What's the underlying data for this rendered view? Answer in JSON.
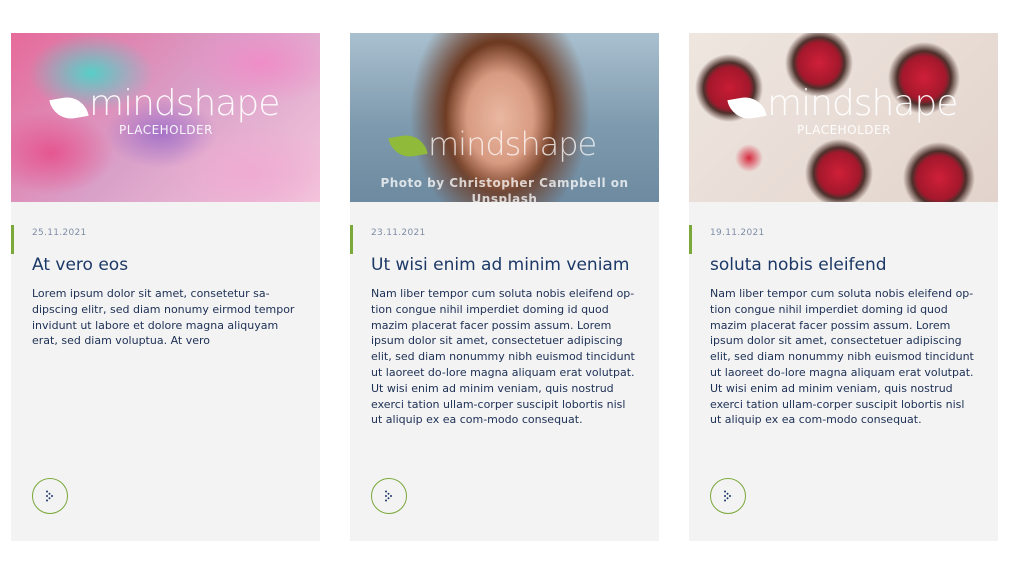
{
  "cards": [
    {
      "image": "donuts-photo",
      "watermark": {
        "brand": "mindshape",
        "sub": "PLACEHOLDER"
      },
      "credit": "",
      "date": "25.11.2021",
      "title": "At vero eos",
      "text": "Lorem ipsum dolor sit amet, consetetur sa-dipscing elitr, sed diam nonumy eirmod tempor invidunt ut labore et dolore magna aliquyam erat, sed diam voluptua. At vero",
      "button_icon": "arrow-right-icon"
    },
    {
      "image": "portrait-photo",
      "watermark": {
        "brand": "mindshape",
        "sub": ""
      },
      "credit": "Photo by Christopher Campbell on Unsplash",
      "date": "23.11.2021",
      "title": "Ut wisi enim ad minim veniam",
      "text": "Nam liber tempor cum soluta nobis eleifend op-tion congue nihil imperdiet doming id quod mazim placerat facer possim assum. Lorem ipsum dolor sit amet, consectetuer adipiscing elit, sed diam nonummy nibh euismod tincidunt ut laoreet do-lore magna aliquam erat volutpat. Ut wisi enim ad minim veniam, quis nostrud exerci tation ullam-corper suscipit lobortis nisl ut aliquip ex ea com-modo consequat.",
      "button_icon": "arrow-right-icon"
    },
    {
      "image": "raspberry-tarts-photo",
      "watermark": {
        "brand": "mindshape",
        "sub": "PLACEHOLDER"
      },
      "credit": "",
      "date": "19.11.2021",
      "title": "soluta nobis eleifend",
      "text": "Nam liber tempor cum soluta nobis eleifend op-tion congue nihil imperdiet doming id quod mazim placerat facer possim assum. Lorem ipsum dolor sit amet, consectetuer adipiscing elit, sed diam nonummy nibh euismod tincidunt ut laoreet do-lore magna aliquam erat volutpat. Ut wisi enim ad minim veniam, quis nostrud exerci tation ullam-corper suscipit lobortis nisl ut aliquip ex ea com-modo consequat.",
      "button_icon": "arrow-right-icon"
    }
  ],
  "colors": {
    "accent": "#7aa83a",
    "title": "#1c3866",
    "text": "#1c2f54",
    "date": "#7f8da6",
    "card_bg": "#f3f3f3"
  }
}
